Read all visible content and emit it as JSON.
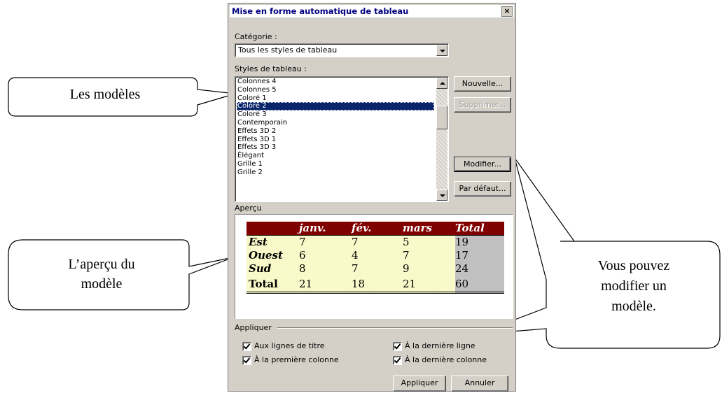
{
  "dialog": {
    "title": "Mise en forme automatique de tableau",
    "close_label": "×",
    "category_label": "Catégorie :",
    "category_value": "Tous les styles de tableau",
    "styles_label": "Styles de tableau :",
    "styles": [
      "Colonnes 4",
      "Colonnes 5",
      "Coloré 1",
      "Coloré 2",
      "Coloré 3",
      "Contemporain",
      "Effets 3D  2",
      "Effets 3D 1",
      "Effets 3D 3",
      "Élégant",
      "Grille 1",
      "Grille 2"
    ],
    "selected_style": "Coloré 2",
    "buttons": {
      "new": "Nouvelle...",
      "delete": "Supprimer...",
      "modify": "Modifier...",
      "default": "Par défaut...",
      "apply": "Appliquer",
      "cancel": "Annuler"
    },
    "preview_label": "Aperçu",
    "preview": {
      "headers": [
        "",
        "janv.",
        "fév.",
        "mars",
        "Total"
      ],
      "rows": [
        [
          "Est",
          "7",
          "7",
          "5",
          "19"
        ],
        [
          "Ouest",
          "6",
          "4",
          "7",
          "17"
        ],
        [
          "Sud",
          "8",
          "7",
          "9",
          "24"
        ],
        [
          "Total",
          "21",
          "18",
          "21",
          "60"
        ]
      ]
    },
    "apply_label": "Appliquer",
    "options": {
      "title_rows": "Aux lignes de titre",
      "first_column": "À la première colonne",
      "last_row": "À la dernière ligne",
      "last_column": "À la dernière colonne"
    }
  },
  "callouts": {
    "models": "Les modèles",
    "preview_line1": "L’aperçu du",
    "preview_line2": "modèle",
    "modify_line1": "Vous pouvez",
    "modify_line2": "modifier un",
    "modify_line3": "modèle."
  }
}
